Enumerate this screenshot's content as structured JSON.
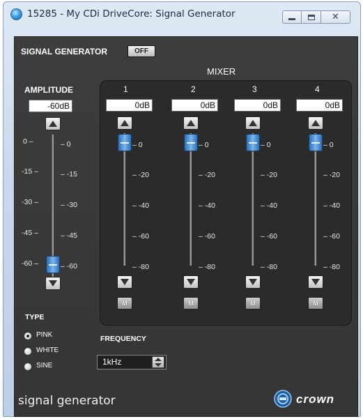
{
  "window": {
    "title": "15285 - My CDi DriveCore: Signal Generator",
    "close_glyph": "✕"
  },
  "generator": {
    "label": "SIGNAL GENERATOR",
    "power_label": "OFF"
  },
  "amplitude": {
    "label": "AMPLITUDE",
    "value": "-60dB",
    "level_db": -60,
    "left_ticks": [
      "0",
      "-15",
      "-30",
      "-45",
      "-60"
    ],
    "right_ticks": [
      "0",
      "-15",
      "-30",
      "-45",
      "-60"
    ]
  },
  "mixer": {
    "label": "MIXER",
    "channels": [
      {
        "number": "1",
        "value": "0dB",
        "mute_label": "M"
      },
      {
        "number": "2",
        "value": "0dB",
        "mute_label": "M"
      },
      {
        "number": "3",
        "value": "0dB",
        "mute_label": "M"
      },
      {
        "number": "4",
        "value": "0dB",
        "mute_label": "M"
      }
    ],
    "ticks": [
      "0",
      "-20",
      "-40",
      "-60",
      "-80"
    ]
  },
  "type": {
    "label": "TYPE",
    "options": [
      "PINK",
      "WHITE",
      "SINE"
    ],
    "selected": "PINK"
  },
  "frequency": {
    "label": "FREQUENCY",
    "value": "1kHz"
  },
  "footer": {
    "title": "signal generator",
    "brand": "crown"
  },
  "colors": {
    "accent_blue": "#3a82cf",
    "panel_dark": "#3d3d3d"
  }
}
